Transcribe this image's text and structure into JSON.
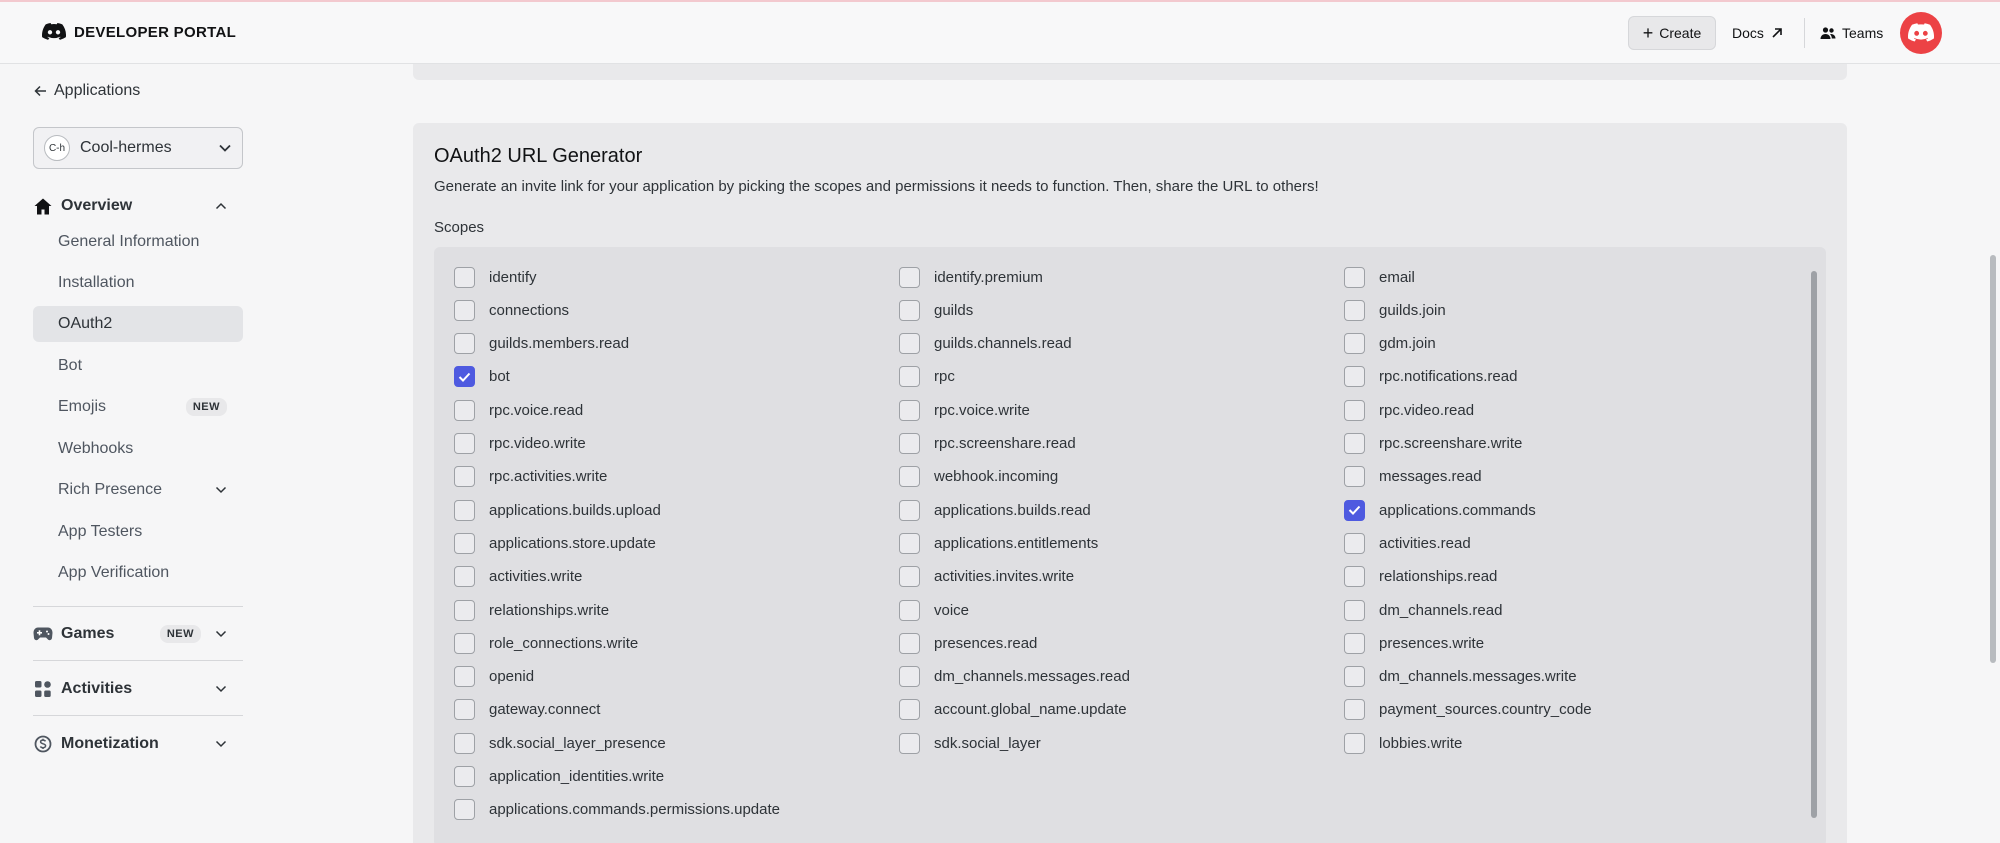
{
  "topbar": {
    "brand": "DEVELOPER PORTAL",
    "create_label": "Create",
    "docs_label": "Docs",
    "teams_label": "Teams"
  },
  "sidebar": {
    "back_label": "Applications",
    "app_badge": "C-h",
    "app_name": "Cool-hermes",
    "overview": "Overview",
    "items": [
      {
        "label": "General Information"
      },
      {
        "label": "Installation"
      },
      {
        "label": "OAuth2"
      },
      {
        "label": "Bot"
      },
      {
        "label": "Emojis",
        "badge": "NEW"
      },
      {
        "label": "Webhooks"
      },
      {
        "label": "Rich Presence"
      },
      {
        "label": "App Testers"
      },
      {
        "label": "App Verification"
      }
    ],
    "games": "Games",
    "games_badge": "NEW",
    "activities": "Activities",
    "monetization": "Monetization"
  },
  "main": {
    "title": "OAuth2 URL Generator",
    "description": "Generate an invite link for your application by picking the scopes and permissions it needs to function. Then, share the URL to others!",
    "scopes_label": "Scopes",
    "scopes": {
      "col1": [
        {
          "label": "identify",
          "checked": false
        },
        {
          "label": "connections",
          "checked": false
        },
        {
          "label": "guilds.members.read",
          "checked": false
        },
        {
          "label": "bot",
          "checked": true
        },
        {
          "label": "rpc.voice.read",
          "checked": false
        },
        {
          "label": "rpc.video.write",
          "checked": false
        },
        {
          "label": "rpc.activities.write",
          "checked": false
        },
        {
          "label": "applications.builds.upload",
          "checked": false
        },
        {
          "label": "applications.store.update",
          "checked": false
        },
        {
          "label": "activities.write",
          "checked": false
        },
        {
          "label": "relationships.write",
          "checked": false
        },
        {
          "label": "role_connections.write",
          "checked": false
        },
        {
          "label": "openid",
          "checked": false
        },
        {
          "label": "gateway.connect",
          "checked": false
        },
        {
          "label": "sdk.social_layer_presence",
          "checked": false
        },
        {
          "label": "application_identities.write",
          "checked": false
        },
        {
          "label": "applications.commands.permissions.update",
          "checked": false
        }
      ],
      "col2": [
        {
          "label": "identify.premium",
          "checked": false
        },
        {
          "label": "guilds",
          "checked": false
        },
        {
          "label": "guilds.channels.read",
          "checked": false
        },
        {
          "label": "rpc",
          "checked": false
        },
        {
          "label": "rpc.voice.write",
          "checked": false
        },
        {
          "label": "rpc.screenshare.read",
          "checked": false
        },
        {
          "label": "webhook.incoming",
          "checked": false
        },
        {
          "label": "applications.builds.read",
          "checked": false
        },
        {
          "label": "applications.entitlements",
          "checked": false
        },
        {
          "label": "activities.invites.write",
          "checked": false
        },
        {
          "label": "voice",
          "checked": false
        },
        {
          "label": "presences.read",
          "checked": false
        },
        {
          "label": "dm_channels.messages.read",
          "checked": false
        },
        {
          "label": "account.global_name.update",
          "checked": false
        },
        {
          "label": "sdk.social_layer",
          "checked": false
        }
      ],
      "col3": [
        {
          "label": "email",
          "checked": false
        },
        {
          "label": "guilds.join",
          "checked": false
        },
        {
          "label": "gdm.join",
          "checked": false
        },
        {
          "label": "rpc.notifications.read",
          "checked": false
        },
        {
          "label": "rpc.video.read",
          "checked": false
        },
        {
          "label": "rpc.screenshare.write",
          "checked": false
        },
        {
          "label": "messages.read",
          "checked": false
        },
        {
          "label": "applications.commands",
          "checked": true
        },
        {
          "label": "activities.read",
          "checked": false
        },
        {
          "label": "relationships.read",
          "checked": false
        },
        {
          "label": "dm_channels.read",
          "checked": false
        },
        {
          "label": "presences.write",
          "checked": false
        },
        {
          "label": "dm_channels.messages.write",
          "checked": false
        },
        {
          "label": "payment_sources.country_code",
          "checked": false
        },
        {
          "label": "lobbies.write",
          "checked": false
        }
      ]
    }
  },
  "colors": {
    "accent": "#4e5ae0",
    "avatar": "#ec4245"
  }
}
